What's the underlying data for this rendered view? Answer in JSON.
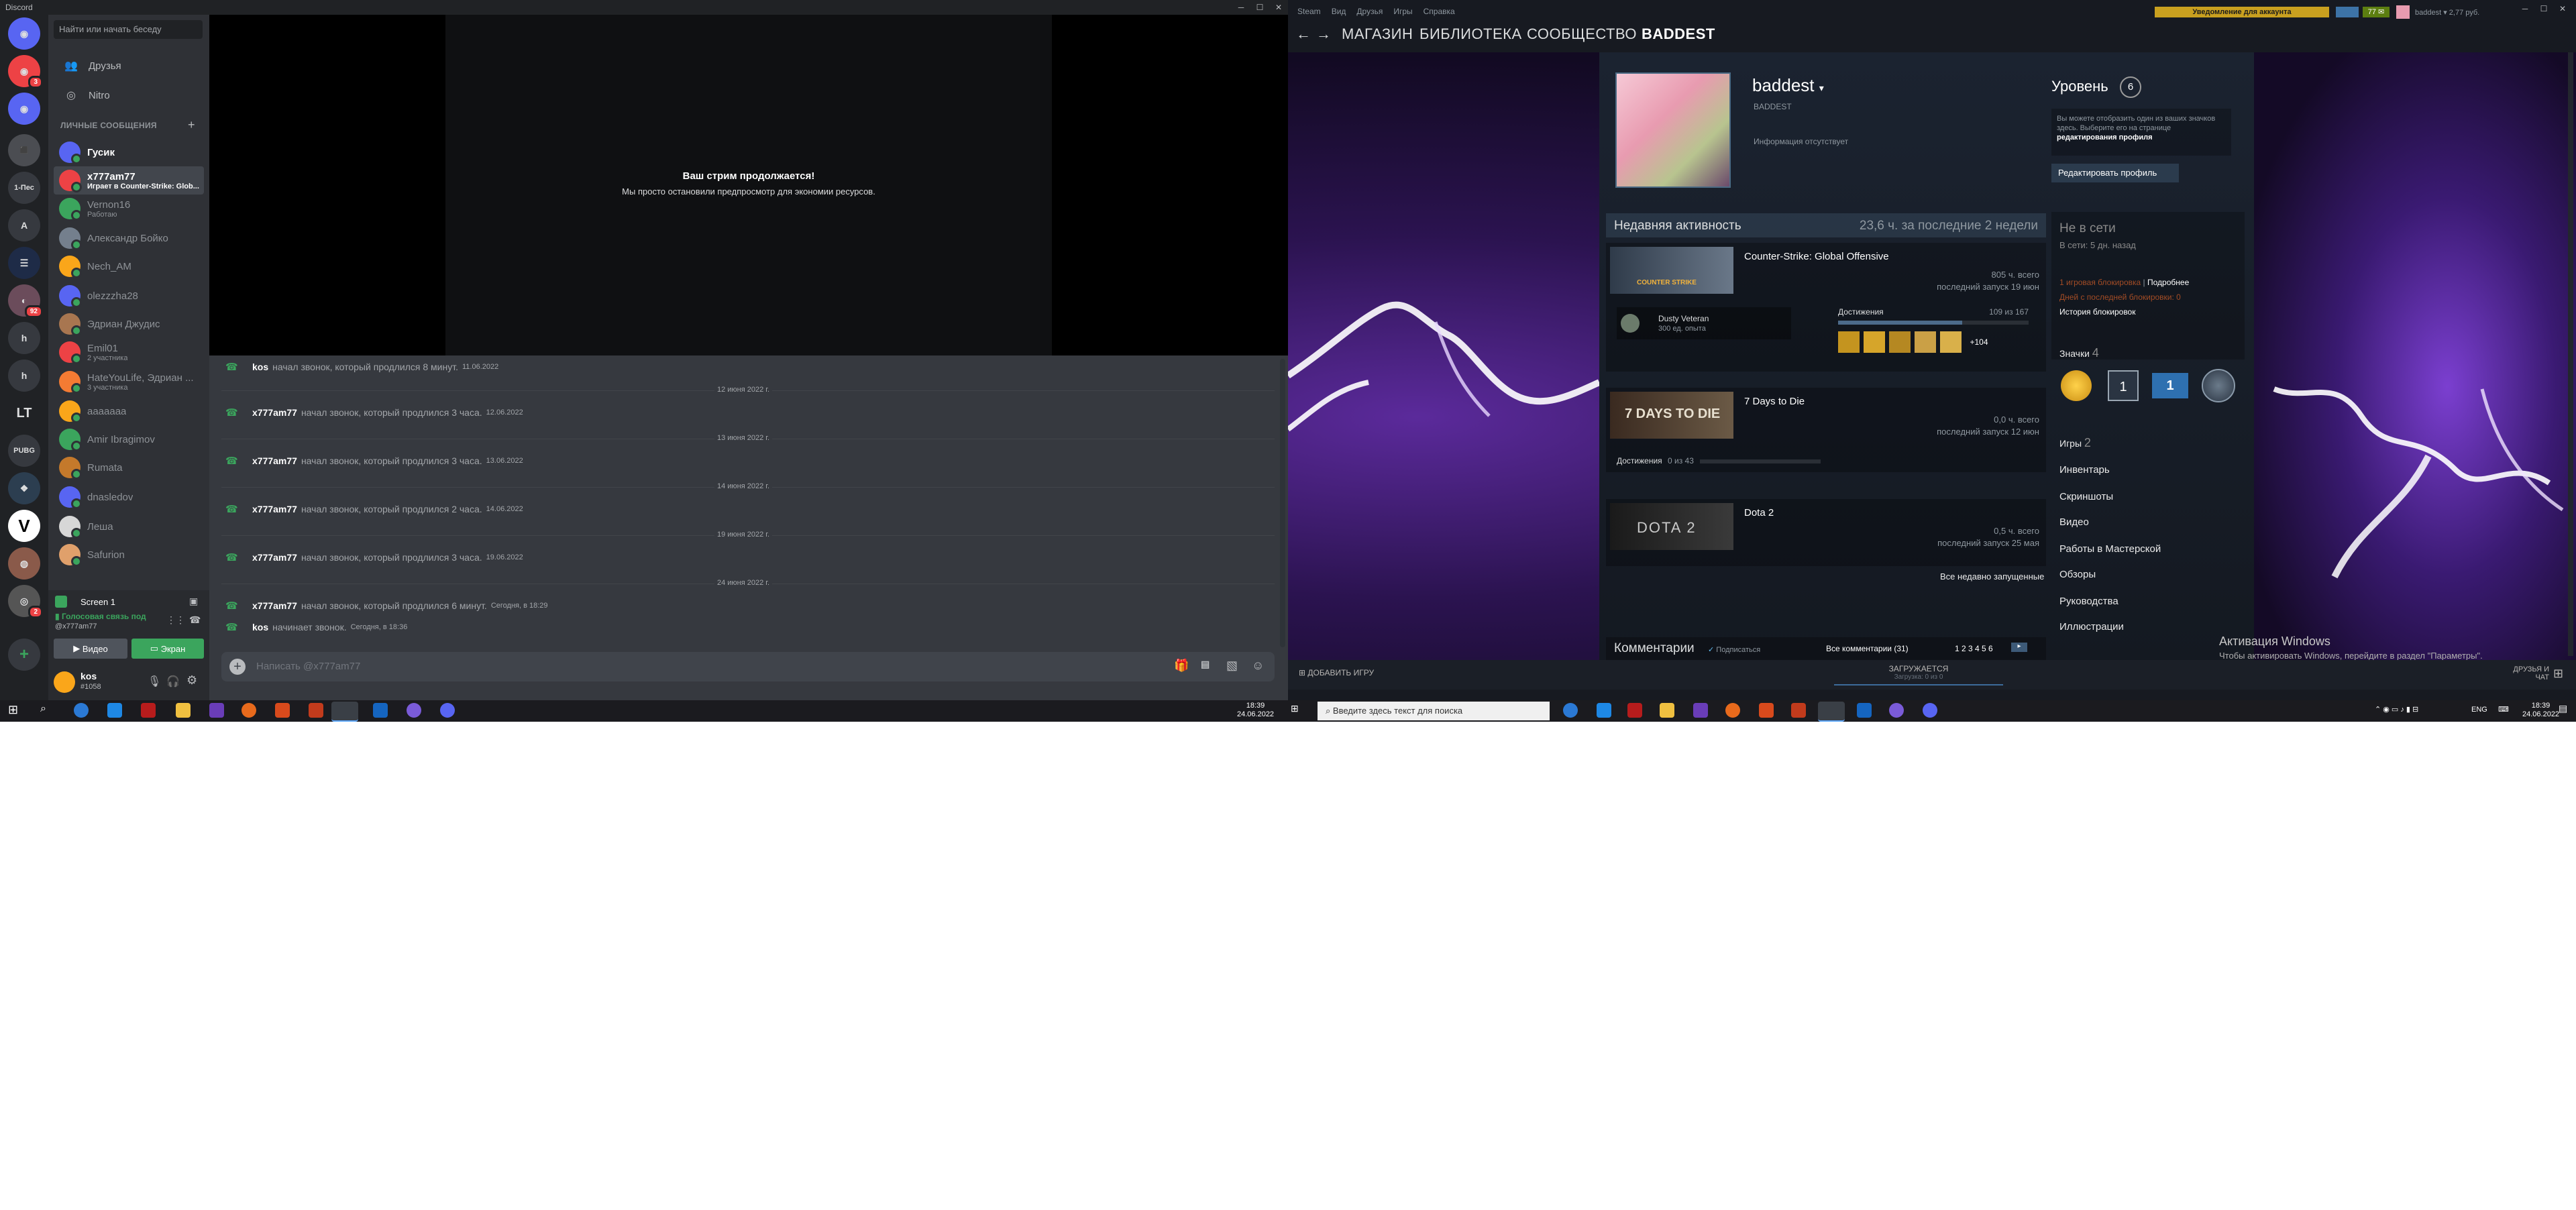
{
  "discord": {
    "window_title": "Discord",
    "guild_badges": {
      "g1": "3",
      "g8": "2",
      "g9": "92",
      "g15": "2"
    },
    "guild_labels": {
      "g5": "1-Пес",
      "g6": "A",
      "g10": "h",
      "g11": "h",
      "g12": "LT",
      "g13": "PUBG",
      "g14": "V"
    },
    "search_placeholder": "Найти или начать беседу",
    "nav": {
      "friends": "Друзья",
      "nitro": "Nitro"
    },
    "dm_header": "ЛИЧНЫЕ СООБЩЕНИЯ",
    "dms": [
      {
        "name": "Гусик",
        "sub": "",
        "color": "#5865f2"
      },
      {
        "name": "x777am77",
        "sub": "Играет в Counter-Strike: Glob...",
        "color": "#ed4245"
      },
      {
        "name": "Vernon16",
        "sub": "Работаю",
        "color": "#3ba55d"
      },
      {
        "name": "Александр Бойко",
        "sub": "",
        "color": "#747f8d"
      },
      {
        "name": "Nech_AM",
        "sub": "",
        "color": "#faa61a"
      },
      {
        "name": "olezzzha28",
        "sub": "",
        "color": "#5865f2"
      },
      {
        "name": "Эдриан Джудис",
        "sub": "",
        "color": "#a87650"
      },
      {
        "name": "Emil01",
        "sub": "2 участника",
        "color": "#ed4245"
      },
      {
        "name": "HateYouLife, Эдриан ...",
        "sub": "3 участника",
        "color": "#f47b33"
      },
      {
        "name": "ааааааа",
        "sub": "",
        "color": "#faa61a"
      },
      {
        "name": "Amir Ibragimov",
        "sub": "",
        "color": "#3ba55d"
      },
      {
        "name": "Rumata",
        "sub": "",
        "color": "#c4792b"
      },
      {
        "name": "dnasledov",
        "sub": "",
        "color": "#5865f2"
      },
      {
        "name": "Леша",
        "sub": "",
        "color": "#d7d7d7"
      },
      {
        "name": "Safurion",
        "sub": "",
        "color": "#e0a06b"
      }
    ],
    "screen_share": "Screen 1",
    "voice_status": "Голосовая связь под",
    "voice_sub": "@x777am77",
    "video_label": "Видео",
    "screen_label": "Экран",
    "user": {
      "name": "kos",
      "tag": "#1058"
    },
    "stream_title": "Ваш стрим продолжается!",
    "stream_sub": "Мы просто остановили предпросмотр для экономии ресурсов.",
    "messages": [
      {
        "type": "msg",
        "name": "kos",
        "text": "начал звонок, который продлился 8 минут.",
        "time": "11.06.2022"
      },
      {
        "type": "div",
        "text": "12 июня 2022 г."
      },
      {
        "type": "msg",
        "name": "x777am77",
        "text": "начал звонок, который продлился 3 часа.",
        "time": "12.06.2022"
      },
      {
        "type": "div",
        "text": "13 июня 2022 г."
      },
      {
        "type": "msg",
        "name": "x777am77",
        "text": "начал звонок, который продлился 3 часа.",
        "time": "13.06.2022"
      },
      {
        "type": "div",
        "text": "14 июня 2022 г."
      },
      {
        "type": "msg",
        "name": "x777am77",
        "text": "начал звонок, который продлился 2 часа.",
        "time": "14.06.2022"
      },
      {
        "type": "div",
        "text": "19 июня 2022 г."
      },
      {
        "type": "msg",
        "name": "x777am77",
        "text": "начал звонок, который продлился 3 часа.",
        "time": "19.06.2022"
      },
      {
        "type": "div",
        "text": "24 июня 2022 г."
      },
      {
        "type": "msg",
        "name": "x777am77",
        "text": "начал звонок, который продлился 6 минут.",
        "time": "Сегодня, в 18:29"
      },
      {
        "type": "msg",
        "name": "kos",
        "text": "начинает звонок.",
        "time": "Сегодня, в 18:36"
      }
    ],
    "input_placeholder": "Написать @x777am77"
  },
  "steam": {
    "menu": [
      "Steam",
      "Вид",
      "Друзья",
      "Игры",
      "Справка"
    ],
    "notice": "Уведомление для аккаунта",
    "notif_count": "77",
    "username": "baddest",
    "balance": "2,77 руб.",
    "nav": [
      "МАГАЗИН",
      "БИБЛИОТЕКА",
      "СООБЩЕСТВО",
      "BADDEST"
    ],
    "profile": {
      "name": "baddest",
      "realname": "BADDEST",
      "info": "Информация отсутствует",
      "level_label": "Уровень",
      "level": "6",
      "showcase_hint_a": "Вы можете отобразить один из ваших значков здесь. Выберите его на странице",
      "showcase_hint_b": "редактирования профиля",
      "edit_button": "Редактировать профиль"
    },
    "activity": {
      "title": "Недавняя активность",
      "hours": "23,6 ч. за последние 2 недели"
    },
    "games": [
      {
        "name": "Counter-Strike: Global Offensive",
        "total": "805 ч. всего",
        "last": "последний запуск 19 июн",
        "img_text": "COUNTER STRIKE"
      },
      {
        "name": "7 Days to Die",
        "total": "0,0 ч. всего",
        "last": "последний запуск 12 июн",
        "img_text": "7 DAYS TO DIE"
      },
      {
        "name": "Dota 2",
        "total": "0,5 ч. всего",
        "last": "последний запуск 25 мая",
        "img_text": "DOTA 2"
      }
    ],
    "csgo_badge": {
      "name": "Dusty Veteran",
      "xp": "300 ед. опыта"
    },
    "achievements_label": "Достижения",
    "csgo_ach": "109 из 167",
    "csgo_ach_more": "+104",
    "seven_ach": "0 из 43",
    "recent_link": "Все недавно запущенные",
    "status": {
      "title": "Не в сети",
      "last": "В сети: 5 дн. назад"
    },
    "bans": {
      "line1": "1 игровая блокировка",
      "details": "Подробнее",
      "line2": "Дней с последней блокировки: 0",
      "history": "История блокировок"
    },
    "badges_label": "Значки",
    "badges_count": "4",
    "badge_one": "1",
    "games_label": "Игры",
    "games_count": "2",
    "links": [
      "Инвентарь",
      "Скриншоты",
      "Видео",
      "Работы в Мастерской",
      "Обзоры",
      "Руководства",
      "Иллюстрации"
    ],
    "comments": {
      "title": "Комментарии",
      "subscribe": "Подписаться",
      "all": "Все комментарии (31)",
      "pages": "1 2 3 4 5 6"
    },
    "add_game": "ДОБАВИТЬ ИГРУ",
    "loading": "ЗАГРУЖАЕТСЯ",
    "loading_sub": "Загрузка: 0 из 0",
    "friends_chat": "ДРУЗЬЯ И ЧАТ",
    "activate_title": "Активация Windows",
    "activate_sub": "Чтобы активировать Windows, перейдите в раздел \"Параметры\"."
  },
  "taskbar": {
    "left_time": "18:39",
    "left_date": "24.06.2022",
    "search_placeholder": "Введите здесь текст для поиска",
    "lang": "ENG",
    "right_time": "18:39",
    "right_date": "24.06.2022"
  }
}
